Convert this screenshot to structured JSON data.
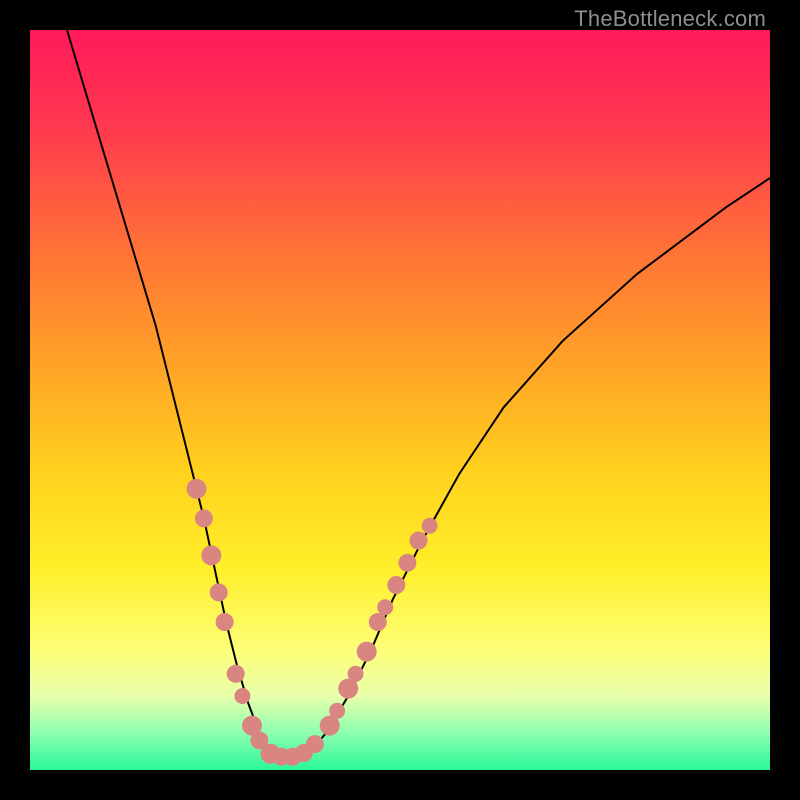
{
  "watermark": "TheBottleneck.com",
  "gradient_stops": [
    {
      "pct": 0,
      "color": "#ff1a5a"
    },
    {
      "pct": 12,
      "color": "#ff3550"
    },
    {
      "pct": 30,
      "color": "#ff7336"
    },
    {
      "pct": 45,
      "color": "#ffa227"
    },
    {
      "pct": 60,
      "color": "#ffd21e"
    },
    {
      "pct": 73,
      "color": "#ffef2a"
    },
    {
      "pct": 84,
      "color": "#fdff7a"
    },
    {
      "pct": 90,
      "color": "#e8ffab"
    },
    {
      "pct": 95,
      "color": "#8dffb0"
    },
    {
      "pct": 100,
      "color": "#2cf79a"
    }
  ],
  "chart_data": {
    "type": "line",
    "title": "",
    "xlabel": "",
    "ylabel": "",
    "xlim": [
      0,
      100
    ],
    "ylim": [
      0,
      100
    ],
    "series": [
      {
        "name": "bottleneck-curve",
        "x": [
          5,
          8,
          11,
          14,
          17,
          19.5,
          21.5,
          23.5,
          25,
          26.5,
          28,
          29.5,
          31,
          32.5,
          34,
          36,
          38,
          40,
          43,
          46,
          49,
          53,
          58,
          64,
          72,
          82,
          94,
          100
        ],
        "y": [
          100,
          90,
          80,
          70,
          60,
          50,
          42,
          34,
          27,
          20,
          14,
          9,
          5,
          2.5,
          1.8,
          1.8,
          2.6,
          5,
          10,
          16,
          23,
          31,
          40,
          49,
          58,
          67,
          76,
          80
        ]
      }
    ],
    "scatter": {
      "name": "highlight-dots",
      "color": "#d98682",
      "points": [
        {
          "x": 22.5,
          "y": 38,
          "r": 10
        },
        {
          "x": 23.5,
          "y": 34,
          "r": 9
        },
        {
          "x": 24.5,
          "y": 29,
          "r": 10
        },
        {
          "x": 25.5,
          "y": 24,
          "r": 9
        },
        {
          "x": 26.3,
          "y": 20,
          "r": 9
        },
        {
          "x": 27.8,
          "y": 13,
          "r": 9
        },
        {
          "x": 28.7,
          "y": 10,
          "r": 8
        },
        {
          "x": 30.0,
          "y": 6,
          "r": 10
        },
        {
          "x": 31.0,
          "y": 4,
          "r": 9
        },
        {
          "x": 32.5,
          "y": 2.2,
          "r": 10
        },
        {
          "x": 34.0,
          "y": 1.8,
          "r": 9
        },
        {
          "x": 35.5,
          "y": 1.8,
          "r": 9
        },
        {
          "x": 37.0,
          "y": 2.3,
          "r": 9
        },
        {
          "x": 38.5,
          "y": 3.5,
          "r": 9
        },
        {
          "x": 40.5,
          "y": 6,
          "r": 10
        },
        {
          "x": 41.5,
          "y": 8,
          "r": 8
        },
        {
          "x": 43.0,
          "y": 11,
          "r": 10
        },
        {
          "x": 44.0,
          "y": 13,
          "r": 8
        },
        {
          "x": 45.5,
          "y": 16,
          "r": 10
        },
        {
          "x": 47.0,
          "y": 20,
          "r": 9
        },
        {
          "x": 48.0,
          "y": 22,
          "r": 8
        },
        {
          "x": 49.5,
          "y": 25,
          "r": 9
        },
        {
          "x": 51.0,
          "y": 28,
          "r": 9
        },
        {
          "x": 52.5,
          "y": 31,
          "r": 9
        },
        {
          "x": 54.0,
          "y": 33,
          "r": 8
        }
      ]
    }
  }
}
